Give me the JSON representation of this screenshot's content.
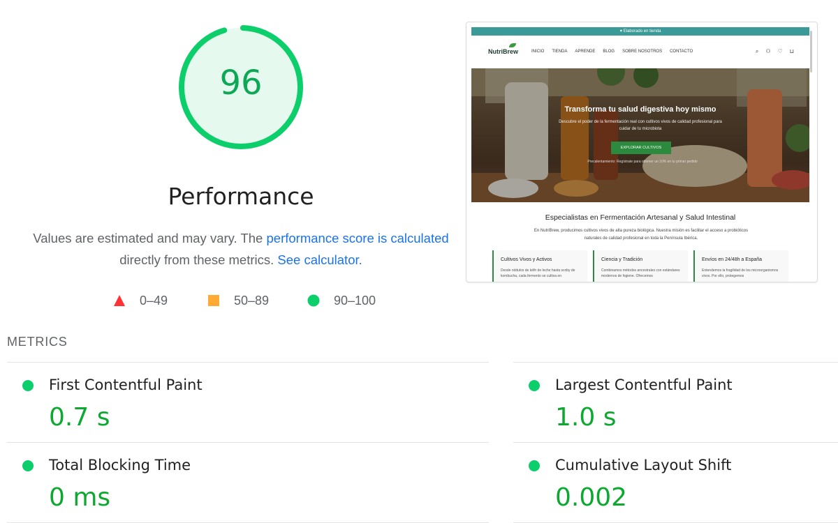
{
  "gauge": {
    "score": "96",
    "score_value": 0.96,
    "color": "#0cce6b",
    "bg": "#e6f9ef"
  },
  "performance": {
    "title": "Performance",
    "desc_prefix": "Values are estimated and may vary. The ",
    "desc_link": "performance score is calculated",
    "desc_mid": " directly from these metrics. ",
    "desc_link2": "See calculator."
  },
  "legend": [
    {
      "icon": "triangle-icon",
      "label": "0–49",
      "color": "#ff3333"
    },
    {
      "icon": "square-icon",
      "label": "50–89",
      "color": "#ffaa33"
    },
    {
      "icon": "circle-icon",
      "label": "90–100",
      "color": "#0cce6b"
    }
  ],
  "metrics": {
    "heading": "METRICS",
    "items": [
      {
        "name": "First Contentful Paint",
        "value": "0.7 s"
      },
      {
        "name": "Largest Contentful Paint",
        "value": "1.0 s"
      },
      {
        "name": "Total Blocking Time",
        "value": "0 ms"
      },
      {
        "name": "Cumulative Layout Shift",
        "value": "0.002"
      }
    ]
  },
  "screenshot": {
    "banner": "♥ Elaborado en tienda",
    "logo": "NutriBrew",
    "menu": [
      "INICIO",
      "TIENDA",
      "APRENDE",
      "BLOG",
      "SOBRE NOSOTROS",
      "CONTACTO"
    ],
    "hero_title": "Transforma tu salud digestiva hoy mismo",
    "hero_sub": "Descubre el poder de la fermentación real con cultivos vivos de calidad profesional para cuidar de tu microbiota",
    "hero_button": "EXPLORAR CULTIVOS",
    "hero_note": "Precalentamiento: Regístrate para obtener un 10% en tu primer pedido",
    "section_title": "Especialistas en Fermentación Artesanal y Salud Intestinal",
    "section_text": "En NutriBrew, producimos cultivos vivos de alta pureza biológica. Nuestra misión es facilitar el acceso a probióticos naturales de calidad profesional en toda la Península Ibérica.",
    "cards": [
      {
        "title": "Cultivos Vivos y Activos",
        "text": "Desde nódulos de kéfir de leche hasta scoby de kombucha, cada fermento se cultiva en"
      },
      {
        "title": "Ciencia y Tradición",
        "text": "Combinamos métodos ancestrales con estándares modernos de higiene. Ofrecemos"
      },
      {
        "title": "Envíos en 24/48h a España",
        "text": "Entendemos la fragilidad de los microorganismos vivos. Por ello, protegemos"
      }
    ]
  }
}
